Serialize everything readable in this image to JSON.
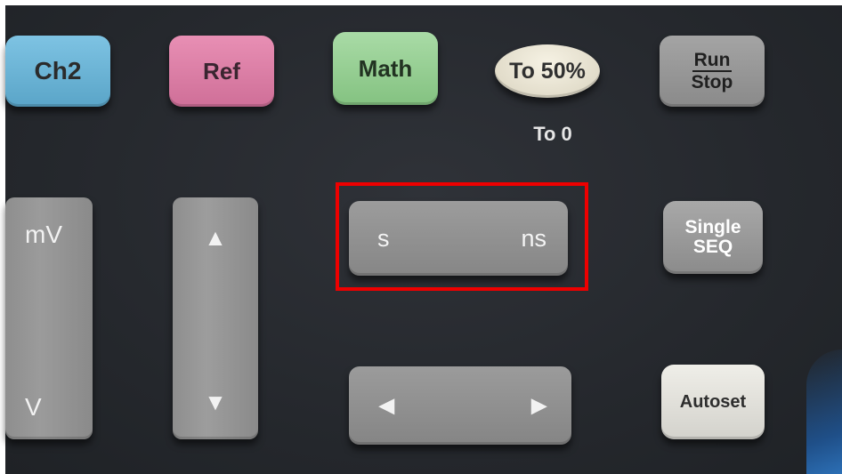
{
  "keys": {
    "ch2": "Ch2",
    "ref": "Ref",
    "math": "Math",
    "to50": "To 50%",
    "to0": "To 0",
    "run_top": "Run",
    "run_bottom": "Stop",
    "single_top": "Single",
    "single_bottom": "SEQ",
    "autoset": "Autoset",
    "volts_top": "mV",
    "volts_bottom": "V",
    "time_left": "s",
    "time_right": "ns"
  },
  "icons": {
    "up": "triangle-up-icon",
    "down": "triangle-down-icon",
    "left": "triangle-left-icon",
    "right": "triangle-right-icon"
  },
  "colors": {
    "ch2": "#6fb6d8",
    "ref": "#dc7fa7",
    "math": "#96cf93",
    "highlight": "#ee0000"
  }
}
